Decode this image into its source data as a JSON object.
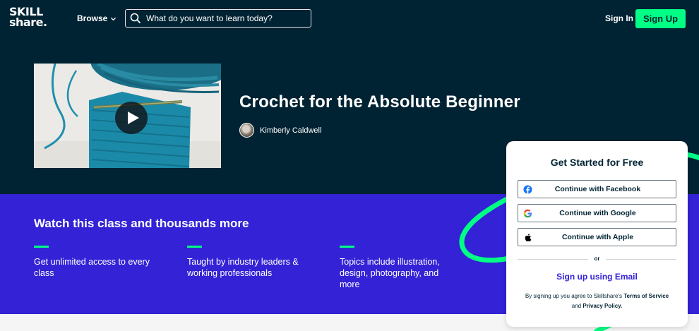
{
  "header": {
    "logo_line1": "SKILL",
    "logo_line2": "share.",
    "browse_label": "Browse",
    "search_placeholder": "What do you want to learn today?",
    "signin_label": "Sign In",
    "signup_label": "Sign Up"
  },
  "hero": {
    "class_title": "Crochet for the Absolute Beginner",
    "teacher_name": "Kimberly Caldwell"
  },
  "promo": {
    "title": "Watch this class and thousands more",
    "features": [
      "Get unlimited access to every class",
      "Taught by industry leaders & working professionals",
      "Topics include illustration, design, photography, and more"
    ]
  },
  "signup_card": {
    "title": "Get Started for Free",
    "facebook_label": "Continue with Facebook",
    "google_label": "Continue with Google",
    "apple_label": "Continue with Apple",
    "or_label": "or",
    "email_label": "Sign up using Email",
    "terms_prefix": "By signing up you agree to Skillshare's",
    "terms_link": "Terms of Service",
    "terms_and": "and",
    "privacy_link": "Privacy Policy."
  },
  "colors": {
    "navy": "#002333",
    "accent_green": "#00ff84",
    "promo_blue": "#3322d6"
  },
  "icons": [
    "search-icon",
    "chevron-down-icon",
    "play-icon",
    "facebook-icon",
    "google-icon",
    "apple-icon"
  ]
}
